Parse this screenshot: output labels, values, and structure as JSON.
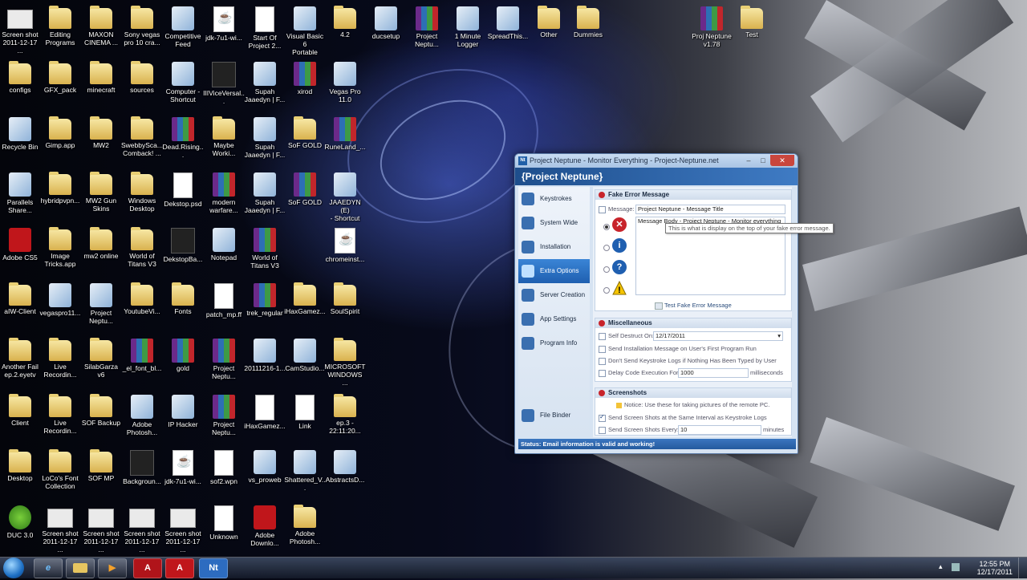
{
  "desktop_icons": [
    {
      "label": "Screen shot\n2011-12-17 ...",
      "type": "screen"
    },
    {
      "label": "Editing\nPrograms",
      "type": "folder"
    },
    {
      "label": "MAXON\nCINEMA ...",
      "type": "folder"
    },
    {
      "label": "Sony vegas\npro 10 cra...",
      "type": "folder"
    },
    {
      "label": "Competitive\nFeed",
      "type": "app"
    },
    {
      "label": "jdk-7u1-wi...",
      "type": "java"
    },
    {
      "label": "Start Of\nProject 2...",
      "type": "file"
    },
    {
      "label": "Visual Basic 6\nPortable",
      "type": "app"
    },
    {
      "label": "4.2",
      "type": "folder"
    },
    {
      "label": "ducsetup",
      "type": "app"
    },
    {
      "label": "Project\nNeptu...",
      "type": "rar"
    },
    {
      "label": "1 Minute\nLogger",
      "type": "app"
    },
    {
      "label": "SpreadThis...",
      "type": "app"
    },
    {
      "label": "Other",
      "type": "folder"
    },
    {
      "label": "Dummies",
      "type": "folder"
    },
    {
      "label": "Proj Neptune\nv1.78",
      "type": "rar"
    },
    {
      "label": "Test",
      "type": "folder"
    },
    {
      "label": "configs",
      "type": "folder"
    },
    {
      "label": "GFX_pack",
      "type": "folder"
    },
    {
      "label": "minecraft",
      "type": "folder"
    },
    {
      "label": "sources",
      "type": "folder"
    },
    {
      "label": "Computer -\nShortcut",
      "type": "app"
    },
    {
      "label": "IIIViceVersal...",
      "type": "dark"
    },
    {
      "label": "Supah\nJaaedyn | F...",
      "type": "app"
    },
    {
      "label": "xirod",
      "type": "rar"
    },
    {
      "label": "Vegas Pro\n11.0",
      "type": "app"
    },
    {
      "label": "Recycle Bin",
      "type": "app"
    },
    {
      "label": "Gimp.app",
      "type": "folder"
    },
    {
      "label": "MW2",
      "type": "folder"
    },
    {
      "label": "SwebbySca...\nComback! ...",
      "type": "folder"
    },
    {
      "label": "Dead.Rising...",
      "type": "rar"
    },
    {
      "label": "Maybe\nWorki...",
      "type": "folder"
    },
    {
      "label": "Supah\nJaaedyn | F...",
      "type": "app"
    },
    {
      "label": "SoF GOLD",
      "type": "folder"
    },
    {
      "label": "RuneLand_...",
      "type": "rar"
    },
    {
      "label": "Parallels\nShare...",
      "type": "app"
    },
    {
      "label": "hybridpvpn...",
      "type": "folder"
    },
    {
      "label": "MW2 Gun\nSkins",
      "type": "folder"
    },
    {
      "label": "Windows\nDesktop",
      "type": "folder"
    },
    {
      "label": "Dekstop.psd",
      "type": "file"
    },
    {
      "label": "modern\nwarfare...",
      "type": "rar"
    },
    {
      "label": "Supah\nJaaedyn | F...",
      "type": "app"
    },
    {
      "label": "SoF GOLD",
      "type": "rar"
    },
    {
      "label": "JAAEDYN (E)\n- Shortcut",
      "type": "app"
    },
    {
      "label": "Adobe CS5",
      "type": "red"
    },
    {
      "label": "Image\nTricks.app",
      "type": "folder"
    },
    {
      "label": "mw2 online",
      "type": "folder"
    },
    {
      "label": "World of\nTitans V3",
      "type": "folder"
    },
    {
      "label": "DekstopBa...",
      "type": "dark"
    },
    {
      "label": "Notepad",
      "type": "app"
    },
    {
      "label": "World of\nTitans V3",
      "type": "rar"
    },
    {
      "label": "chromeinst...",
      "type": "java"
    },
    {
      "label": "aIW-Client",
      "type": "folder"
    },
    {
      "label": "vegaspro11...",
      "type": "app"
    },
    {
      "label": "Project\nNeptu...",
      "type": "app"
    },
    {
      "label": "YoutubeVi...",
      "type": "folder"
    },
    {
      "label": "Fonts",
      "type": "folder"
    },
    {
      "label": "patch_mp.ff",
      "type": "file"
    },
    {
      "label": "trek_regular",
      "type": "rar"
    },
    {
      "label": "iHaxGamez...",
      "type": "folder"
    },
    {
      "label": "SoulSpirit",
      "type": "folder"
    },
    {
      "label": "Another Fail\nep.2.eyetv",
      "type": "folder"
    },
    {
      "label": "Live\nRecordin...",
      "type": "folder"
    },
    {
      "label": "SilabGarza v6",
      "type": "folder"
    },
    {
      "label": "_el_font_bl...",
      "type": "rar"
    },
    {
      "label": "gold",
      "type": "rar"
    },
    {
      "label": "Project\nNeptu...",
      "type": "rar"
    },
    {
      "label": "20111216-1...",
      "type": "app"
    },
    {
      "label": "CamStudio...",
      "type": "app"
    },
    {
      "label": "MICROSOFT\nWINDOWS ...",
      "type": "folder"
    },
    {
      "label": "Client",
      "type": "folder"
    },
    {
      "label": "Live\nRecordin...",
      "type": "folder"
    },
    {
      "label": "SOF Backup",
      "type": "folder"
    },
    {
      "label": "Adobe\nPhotosh...",
      "type": "app"
    },
    {
      "label": "IP Hacker",
      "type": "app"
    },
    {
      "label": "Project\nNeptu...",
      "type": "rar"
    },
    {
      "label": "iHaxGamez...",
      "type": "file"
    },
    {
      "label": "Link",
      "type": "file"
    },
    {
      "label": "ep.3 -\n22:11:20...",
      "type": "folder"
    },
    {
      "label": "Desktop",
      "type": "folder"
    },
    {
      "label": "LoCo's Font\nCollection",
      "type": "folder"
    },
    {
      "label": "SOF MP",
      "type": "folder"
    },
    {
      "label": "Backgroun...",
      "type": "dark"
    },
    {
      "label": "jdk-7u1-wi...",
      "type": "java"
    },
    {
      "label": "sof2.wpn",
      "type": "file"
    },
    {
      "label": "vs_proweb",
      "type": "app"
    },
    {
      "label": "Shattered_V...",
      "type": "app"
    },
    {
      "label": "AbstractsD...",
      "type": "app"
    },
    {
      "label": "DUC 3.0",
      "type": "green"
    },
    {
      "label": "Screen shot\n2011-12-17 ...",
      "type": "screen"
    },
    {
      "label": "Screen shot\n2011-12-17 ...",
      "type": "screen"
    },
    {
      "label": "Screen shot\n2011-12-17 ...",
      "type": "screen"
    },
    {
      "label": "Screen shot\n2011-12-17 ...",
      "type": "screen"
    },
    {
      "label": "Unknown",
      "type": "file"
    },
    {
      "label": "Adobe\nDownlo...",
      "type": "red"
    },
    {
      "label": "Adobe\nPhotosh...",
      "type": "folder"
    }
  ],
  "window": {
    "title": "Project Neptune - Monitor Everything - Project-Neptune.net",
    "title_icon": "Nt",
    "header": "{Project Neptune}",
    "nav": [
      {
        "label": "Keystrokes",
        "icon": "keyboard-icon"
      },
      {
        "label": "System Wide",
        "icon": "globe-icon"
      },
      {
        "label": "Installation",
        "icon": "installer-icon"
      },
      {
        "label": "Extra Options",
        "icon": "gear-icon",
        "active": true
      },
      {
        "label": "Server Creation",
        "icon": "server-icon"
      },
      {
        "label": "App Settings",
        "icon": "tools-icon"
      },
      {
        "label": "Program Info",
        "icon": "info-icon"
      },
      {
        "label": "File Binder",
        "icon": "binder-icon"
      }
    ],
    "fake_error": {
      "title": "Fake Error Message",
      "message_label": "Message:",
      "message_value": "Project Neptune - Message Title",
      "body_value": "Message Body - Project Neptune - Monitor everything",
      "tooltip": "This is what is display on the top of your fake error message.",
      "test_button": "Test Fake Error Message",
      "selected_icon": "error"
    },
    "misc": {
      "title": "Miscellaneous",
      "self_destruct_label": "Self Destruct On:",
      "self_destruct_date": "12/17/2011",
      "send_install_label": "Send Installation Message on User's First Program Run",
      "dont_send_label": "Don't Send Keystroke Logs if Nothing Has Been Typed by User",
      "delay_label": "Delay Code Execution For:",
      "delay_value": "1000",
      "delay_unit": "milliseconds"
    },
    "screenshots": {
      "title": "Screenshots",
      "notice": "Notice:  Use these for taking pictures of the remote PC.",
      "same_interval_label": "Send Screen Shots at the Same Interval as Keystroke Logs",
      "same_interval_checked": true,
      "every_label": "Send Screen Shots Every:",
      "every_value": "10",
      "every_unit": "minutes"
    },
    "status": "Status: Email information is valid and working!"
  },
  "taskbar": {
    "pinned": [
      {
        "name": "ie",
        "label": "e"
      },
      {
        "name": "explorer",
        "label": ""
      },
      {
        "name": "media",
        "label": "▶"
      },
      {
        "name": "adobe1",
        "label": "A"
      },
      {
        "name": "adobe2",
        "label": "A"
      },
      {
        "name": "neptune",
        "label": "Nt"
      }
    ],
    "time": "12:55 PM",
    "date": "12/17/2011"
  }
}
